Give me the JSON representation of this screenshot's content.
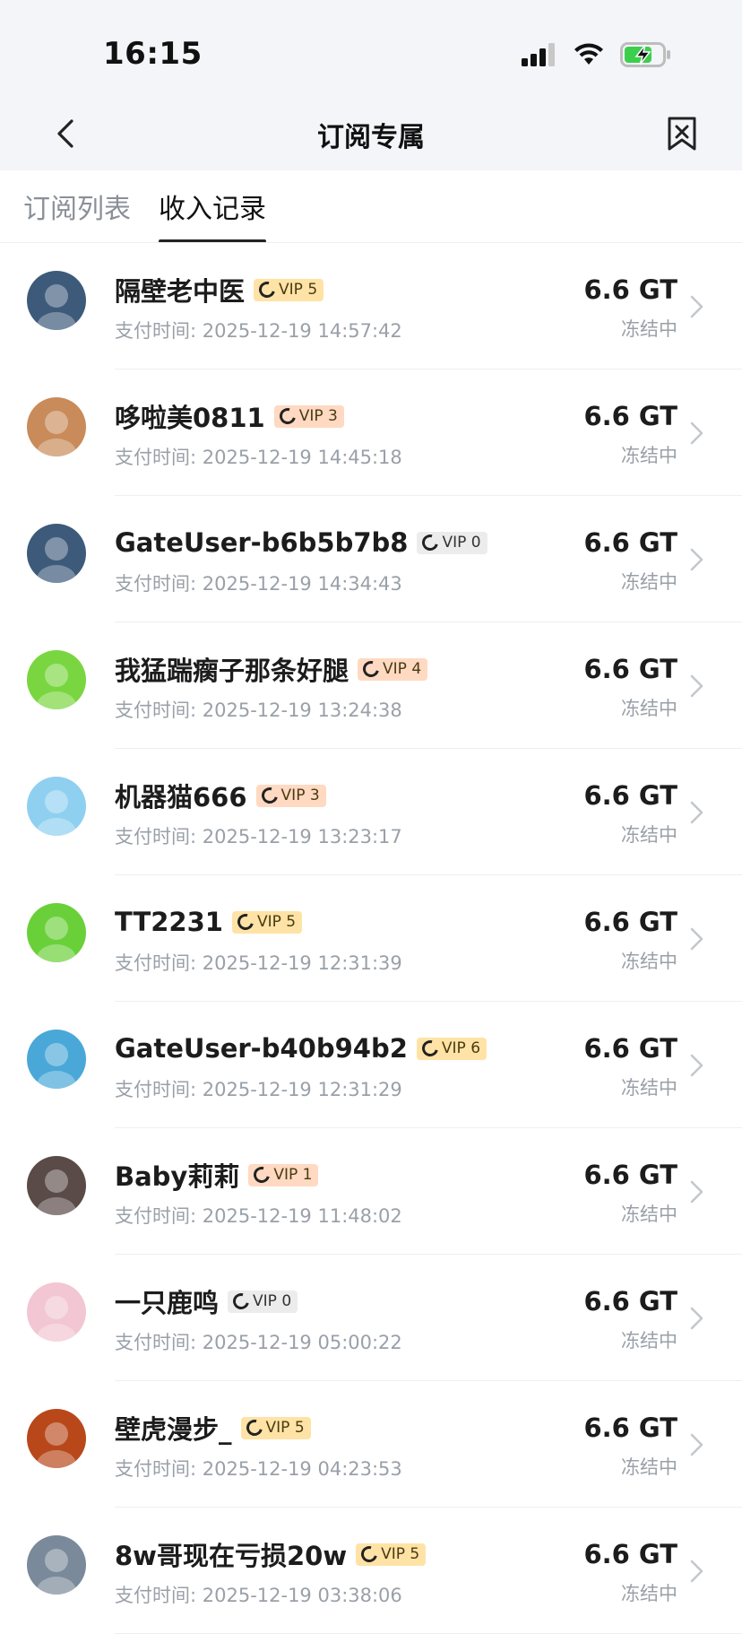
{
  "status": {
    "time": "16:15"
  },
  "nav": {
    "title": "订阅专属",
    "back_icon": "chevron-left-icon",
    "bookmark_icon": "bookmark-icon"
  },
  "tabs": [
    {
      "label": "订阅列表",
      "active": false
    },
    {
      "label": "收入记录",
      "active": true
    }
  ],
  "records": [
    {
      "name": "隔壁老中医",
      "vip": "VIP 5",
      "vip_style": "gold",
      "time": "支付时间: 2025-12-19 14:57:42",
      "amount": "6.6 GT",
      "status": "冻结中",
      "avatar_color": "#3d5a7a"
    },
    {
      "name": "哆啦美0811",
      "vip": "VIP 3",
      "vip_style": "peach",
      "time": "支付时间: 2025-12-19 14:45:18",
      "amount": "6.6 GT",
      "status": "冻结中",
      "avatar_color": "#c98b5a"
    },
    {
      "name": "GateUser-b6b5b7b8",
      "vip": "VIP 0",
      "vip_style": "grey",
      "time": "支付时间: 2025-12-19 14:34:43",
      "amount": "6.6 GT",
      "status": "冻结中",
      "avatar_color": "#3d5a7a"
    },
    {
      "name": "我猛踹瘸子那条好腿",
      "vip": "VIP 4",
      "vip_style": "peach",
      "time": "支付时间: 2025-12-19 13:24:38",
      "amount": "6.6 GT",
      "status": "冻结中",
      "avatar_color": "#7ad640"
    },
    {
      "name": "机器猫666",
      "vip": "VIP 3",
      "vip_style": "peach",
      "time": "支付时间: 2025-12-19 13:23:17",
      "amount": "6.6 GT",
      "status": "冻结中",
      "avatar_color": "#8fd0f0"
    },
    {
      "name": "TT2231",
      "vip": "VIP 5",
      "vip_style": "gold",
      "time": "支付时间: 2025-12-19 12:31:39",
      "amount": "6.6 GT",
      "status": "冻结中",
      "avatar_color": "#6ad03a"
    },
    {
      "name": "GateUser-b40b94b2",
      "vip": "VIP 6",
      "vip_style": "gold",
      "time": "支付时间: 2025-12-19 12:31:29",
      "amount": "6.6 GT",
      "status": "冻结中",
      "avatar_color": "#4aa8d8"
    },
    {
      "name": "Baby莉莉",
      "vip": "VIP 1",
      "vip_style": "peach",
      "time": "支付时间: 2025-12-19 11:48:02",
      "amount": "6.6 GT",
      "status": "冻结中",
      "avatar_color": "#5a4a48"
    },
    {
      "name": "一只鹿鸣",
      "vip": "VIP 0",
      "vip_style": "grey",
      "time": "支付时间: 2025-12-19 05:00:22",
      "amount": "6.6 GT",
      "status": "冻结中",
      "avatar_color": "#f2c6d2"
    },
    {
      "name": "壁虎漫步_",
      "vip": "VIP 5",
      "vip_style": "gold",
      "time": "支付时间: 2025-12-19 04:23:53",
      "amount": "6.6 GT",
      "status": "冻结中",
      "avatar_color": "#b8481a"
    },
    {
      "name": "8w哥现在亏损20w",
      "vip": "VIP 5",
      "vip_style": "gold",
      "time": "支付时间: 2025-12-19 03:38:06",
      "amount": "6.6 GT",
      "status": "冻结中",
      "avatar_color": "#7a8a9a"
    }
  ]
}
